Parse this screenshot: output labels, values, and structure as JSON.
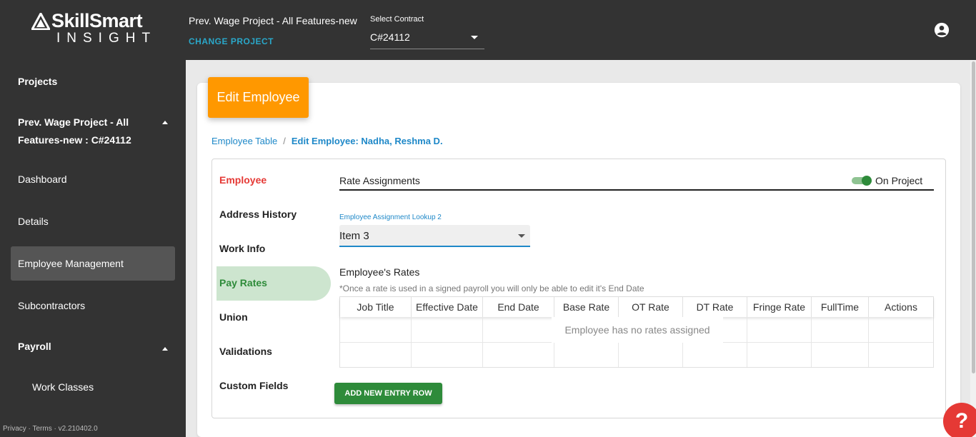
{
  "header": {
    "logo_brand": "SkillSmart",
    "logo_sub": "INSIGHT",
    "project_name": "Prev. Wage Project - All Features-new",
    "change_project": "CHANGE PROJECT",
    "contract_label": "Select Contract",
    "contract_value": "C#24112",
    "account_icon": "account-circle-icon"
  },
  "sidebar": {
    "projects": "Projects",
    "project_full": "Prev. Wage Project - All Features-new : C#24112",
    "items": [
      {
        "label": "Dashboard"
      },
      {
        "label": "Details"
      },
      {
        "label": "Employee Management",
        "active": true
      },
      {
        "label": "Subcontractors"
      },
      {
        "label": "Payroll"
      },
      {
        "label": "Work Classes"
      }
    ],
    "footer": "Privacy · Terms · v2.210402.0"
  },
  "page": {
    "header_title": "Edit Employee",
    "breadcrumb": {
      "parent": "Employee Table",
      "separator": "/",
      "current": "Edit Employee: Nadha, Reshma D."
    }
  },
  "tabs": [
    {
      "label": "Employee",
      "color": "#e53935"
    },
    {
      "label": "Address History"
    },
    {
      "label": "Work Info"
    },
    {
      "label": "Pay Rates",
      "active": true,
      "color": "#2e8b3a"
    },
    {
      "label": "Union"
    },
    {
      "label": "Validations"
    },
    {
      "label": "Custom Fields"
    }
  ],
  "rates": {
    "section_title": "Rate Assignments",
    "toggle_label": "On Project",
    "toggle_on": true,
    "lookup_label": "Employee Assignment Lookup 2",
    "lookup_value": "Item 3",
    "table_title": "Employee's Rates",
    "note": "*Once a rate is used in a signed payroll you will only be able to edit it's End Date",
    "columns": [
      "Job Title",
      "Effective Date",
      "End Date",
      "Base Rate",
      "OT Rate",
      "DT Rate",
      "Fringe Rate",
      "FullTime",
      "Actions"
    ],
    "empty_message": "Employee has no rates assigned",
    "add_button": "ADD NEW ENTRY ROW"
  },
  "help_icon": "?",
  "colors": {
    "topbar": "#333333",
    "accent_orange": "#ff9800",
    "accent_blue": "#1e88c8",
    "accent_green": "#2e8b3a",
    "help_red": "#e53935"
  }
}
